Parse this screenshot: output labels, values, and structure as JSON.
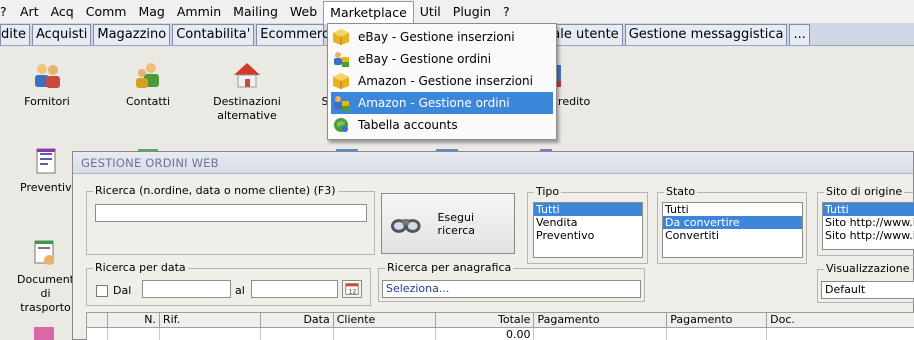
{
  "menu": [
    "?",
    "Art",
    "Acq",
    "Comm",
    "Mag",
    "Ammin",
    "Mailing",
    "Web",
    "Marketplace",
    "Util",
    "Plugin",
    "?"
  ],
  "tabs": [
    "dite",
    "Acquisti",
    "Magazzino",
    "Contabilita'",
    "Ecommerce",
    "ale utente",
    "Gestione messaggistica",
    "..."
  ],
  "dropdown": {
    "items": [
      {
        "label": "eBay - Gestione inserzioni",
        "icon": "ebay-listings-icon"
      },
      {
        "label": "eBay - Gestione ordini",
        "icon": "ebay-orders-icon"
      },
      {
        "label": "Amazon - Gestione inserzioni",
        "icon": "amazon-listings-icon"
      },
      {
        "label": "Amazon - Gestione ordini",
        "icon": "amazon-orders-icon"
      },
      {
        "label": "Tabella accounts",
        "icon": "accounts-table-icon"
      }
    ],
    "selected_index": 3
  },
  "desktop": {
    "icons": [
      {
        "label": "Fornitori",
        "icon": "suppliers-icon"
      },
      {
        "label": "Contatti",
        "icon": "contacts-icon"
      },
      {
        "label": "Destinazioni alternative",
        "icon": "alternative-destinations-icon"
      },
      {
        "label": "S",
        "icon": "partial-icon"
      },
      {
        "label": "credito",
        "icon": "credit-icon"
      },
      {
        "label": "Preventivi",
        "icon": "quotes-icon"
      },
      {
        "label": "Documenti di trasporto",
        "icon": "transport-docs-icon"
      }
    ]
  },
  "window": {
    "title": "GESTIONE ORDINI WEB",
    "search": {
      "label": "Ricerca (n.ordine, data o nome cliente) (F3)",
      "value": "",
      "button": "Esegui ricerca"
    },
    "tipo": {
      "label": "Tipo",
      "options": [
        "Tutti",
        "Vendita",
        "Preventivo"
      ],
      "selected": 0
    },
    "stato": {
      "label": "Stato",
      "options": [
        "Tutti",
        "Da convertire",
        "Convertiti"
      ],
      "selected": 1
    },
    "sito": {
      "label": "Sito di origine",
      "options": [
        "Tutti",
        "Sito http://www.ils",
        "Sito http://www.ils"
      ],
      "selected": 0
    },
    "date": {
      "label": "Ricerca per data",
      "dal": "Dal",
      "al": "al",
      "from": "",
      "to": ""
    },
    "anagrafica": {
      "label": "Ricerca per anagrafica",
      "value": "Seleziona..."
    },
    "visualizzazione": {
      "label": "Visualizzazione",
      "value": "Default"
    },
    "grid": {
      "columns": [
        "",
        "N.",
        "Rif.",
        "Data",
        "Cliente",
        "Totale",
        "Pagamento",
        "Pagamento",
        "Doc."
      ],
      "rows": [
        [
          "",
          "",
          "",
          "",
          "",
          "0.00",
          "",
          "",
          ""
        ]
      ]
    }
  },
  "colors": {
    "selection": "#3c87d9",
    "tab_bg": "#e6ebf5",
    "title_text": "#6a7690"
  }
}
